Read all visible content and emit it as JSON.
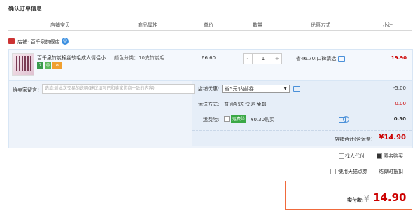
{
  "page": {
    "title": "确认订单信息"
  },
  "header": {
    "columns": [
      "店铺宝贝",
      "商品属性",
      "单价",
      "数量",
      "优惠方式",
      "小计"
    ]
  },
  "shop": {
    "label": "店铺: 百千泉旗舰店"
  },
  "item": {
    "name": "百千泉竹炭棉丝软毛成人情侣小...",
    "attribute": "颜色分类：10支竹炭毛",
    "price": "66.60",
    "quantity": "1",
    "qty_minus": "-",
    "qty_plus": "+",
    "discount": "省46.70:口碑清选",
    "subtotal": "19.90",
    "badges": [
      "7",
      "☺",
      "✉"
    ]
  },
  "order": {
    "message_label": "给卖家留言：",
    "message_placeholder": "选填:对本次交易的说明(建议填写已和卖家协商一致的内容)",
    "coupon_label": "店铺优惠:",
    "coupon_value": "省5元:内部券",
    "coupon_amount": "-5.00",
    "shipping_label": "运送方式:",
    "shipping_value": "普通配送 快递 免邮",
    "shipping_amount": "0.00",
    "insurance_label": "运费险:",
    "insurance_tag": "运费险",
    "insurance_text": "¥0.30购买",
    "insurance_amount": "0.30",
    "total_label": "店铺合计(含运费)",
    "total_value": "¥14.90"
  },
  "options": {
    "pay_for_others": "找人代付",
    "anonymous": "匿名购买",
    "use_coupon": "使用天猫点券",
    "settle_note": "结算时抵扣"
  },
  "payment": {
    "label": "实付款:",
    "currency": "¥",
    "amount": "14.90"
  },
  "colors": {
    "accent": "#f06a3c",
    "price_red": "#c00000",
    "panel_blue": "#eef3fa"
  }
}
